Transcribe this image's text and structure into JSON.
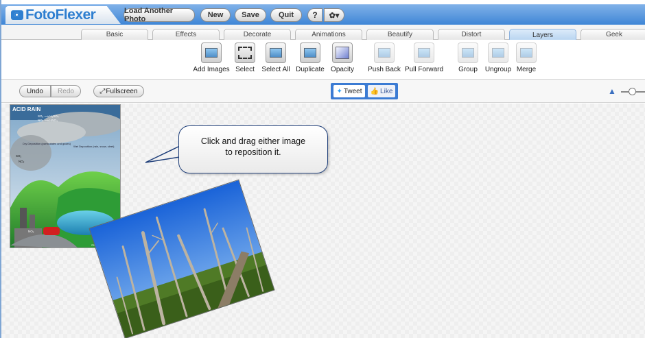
{
  "app": {
    "logo_text": "FotoFlexer"
  },
  "header": {
    "load_label": "Load Another Photo",
    "new_label": "New",
    "save_label": "Save",
    "quit_label": "Quit",
    "help_label": "?",
    "gear_label": "✿▾"
  },
  "tabs": [
    {
      "label": "Basic",
      "active": false
    },
    {
      "label": "Effects",
      "active": false
    },
    {
      "label": "Decorate",
      "active": false
    },
    {
      "label": "Animations",
      "active": false
    },
    {
      "label": "Beautify",
      "active": false
    },
    {
      "label": "Distort",
      "active": false
    },
    {
      "label": "Layers",
      "active": true
    },
    {
      "label": "Geek",
      "active": false
    }
  ],
  "toolbar": {
    "tools": [
      {
        "label": "Add Images",
        "icon": "add-images-icon",
        "enabled": true
      },
      {
        "label": "Select",
        "icon": "select-icon",
        "enabled": true
      },
      {
        "label": "Select All",
        "icon": "select-all-icon",
        "enabled": true
      },
      {
        "label": "Duplicate",
        "icon": "duplicate-icon",
        "enabled": true
      },
      {
        "label": "Opacity",
        "icon": "opacity-icon",
        "enabled": true
      },
      {
        "label": "Push Back",
        "icon": "push-back-icon",
        "enabled": false
      },
      {
        "label": "Pull Forward",
        "icon": "pull-forward-icon",
        "enabled": false
      },
      {
        "label": "Group",
        "icon": "group-icon",
        "enabled": false
      },
      {
        "label": "Ungroup",
        "icon": "ungroup-icon",
        "enabled": false
      },
      {
        "label": "Merge",
        "icon": "merge-icon",
        "enabled": false
      }
    ]
  },
  "subbar": {
    "undo_label": "Undo",
    "redo_label": "Redo",
    "fullscreen_label": "Fullscreen",
    "tweet_label": "Tweet",
    "like_label": "Like"
  },
  "canvas": {
    "callout_line1": "Click and drag either image",
    "callout_line2": "to reposition it.",
    "acid_rain_title": "ACID RAIN",
    "acid_labels": {
      "so2": "SO₂ ⟶ H₂SO₄",
      "nox": "NOₓ ⟶ HNO₃",
      "dry": "Dry Deposition (particulates and gases)",
      "wet": "Wet Deposition (rain, snow, sleet)",
      "so2_left": "SO₂",
      "nox_left": "NOₓ",
      "nox_bottom": "NOₓ",
      "credit": "©2007 H"
    }
  },
  "colors": {
    "header_blue": "#3f86d6",
    "logo_blue": "#2f7fd0",
    "social_blue": "#3b7bd3",
    "active_tab": "#b7d4f0"
  }
}
